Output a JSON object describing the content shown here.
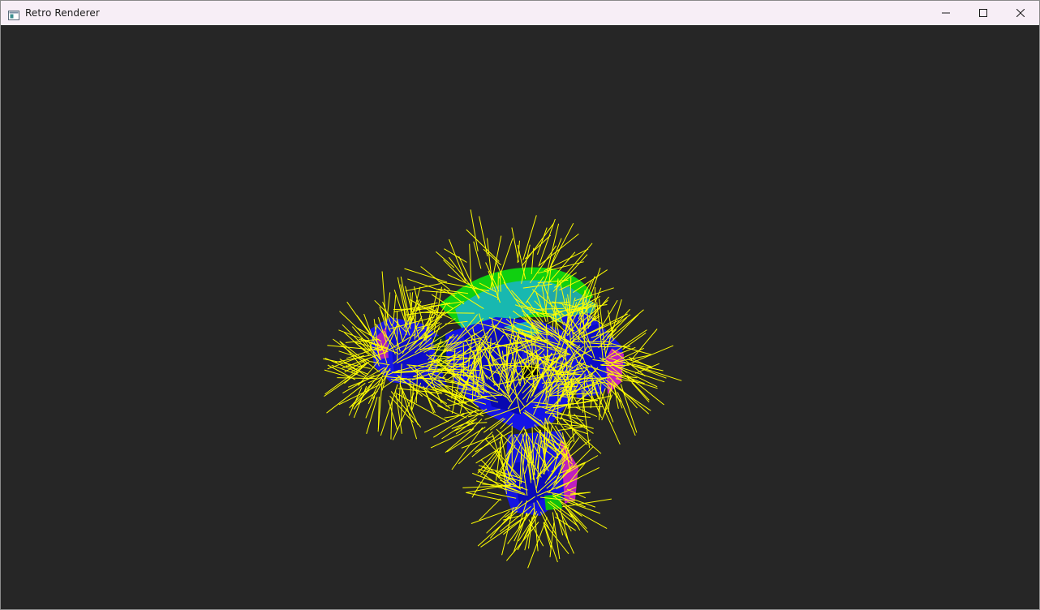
{
  "window": {
    "title": "Retro Renderer",
    "icons": {
      "app": "app-window-icon",
      "minimize": "minimize-icon",
      "maximize": "maximize-icon",
      "close": "close-icon"
    }
  },
  "viewport": {
    "background_color": "#262626",
    "model": "monkey-head-mesh",
    "normal_color": "#ffff00",
    "face_colors": [
      "#1010f0",
      "#14b0b0",
      "#10e010",
      "#c020c0"
    ]
  }
}
